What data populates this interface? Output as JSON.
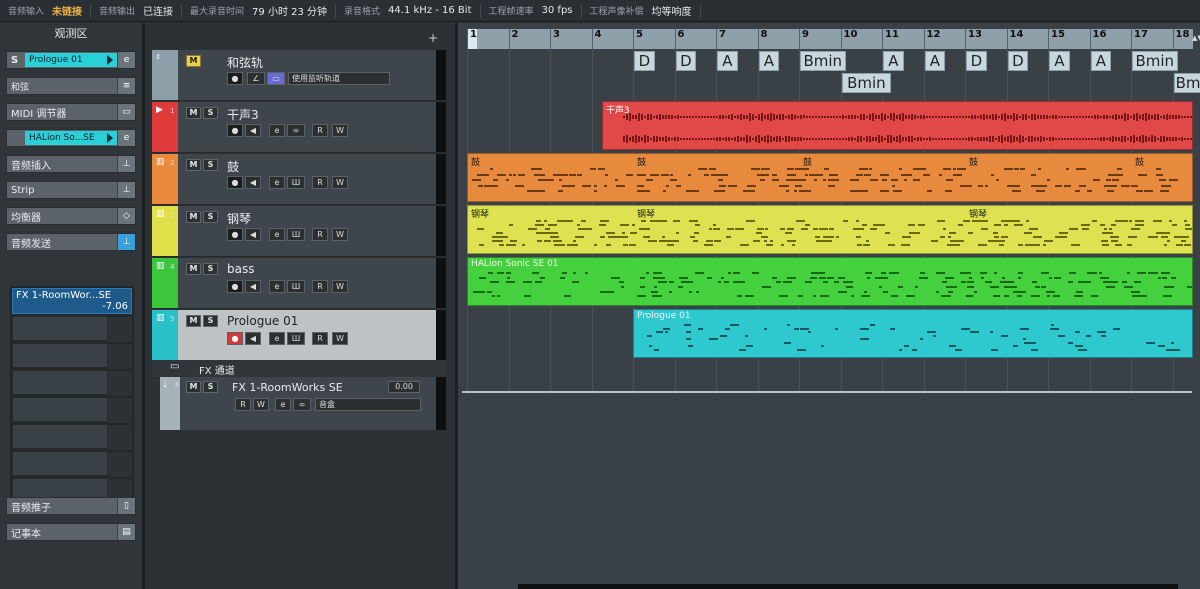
{
  "statusbar": {
    "audio_in_key": "音频输入",
    "audio_in_val": "未链接",
    "audio_out_key": "音频输出",
    "audio_out_val": "已连接",
    "max_rec_key": "最大录音时间",
    "max_rec_val": "79 小时 23 分钟",
    "rec_fmt_key": "录音格式",
    "rec_fmt_val": "44.1 kHz - 16 Bit",
    "frame_key": "工程帧速率",
    "frame_val": "30 fps",
    "pan_key": "工程声像补偿",
    "pan_val": "均等响度"
  },
  "inspector": {
    "title": "观测区",
    "s_label": "S",
    "instrument": "Prologue 01",
    "chords": "和弦",
    "midi_mod": "MIDI 调节器",
    "halion": "HALion So...SE",
    "audio_insert": "音频插入",
    "strip": "Strip",
    "eq": "均衡器",
    "audio_send": "音频发送",
    "send1_name": "FX 1-RoomWor...SE",
    "send1_val": "-7.06",
    "fader": "音频推子",
    "notepad": "记事本"
  },
  "tracks": [
    {
      "num": "",
      "name": "和弦轨",
      "color": "#8d9fa9",
      "mute": "M",
      "solo": "",
      "chord_mode": "使用监听轨道"
    },
    {
      "num": "1",
      "name": "干声3",
      "color": "#e03a3a",
      "mute": "M",
      "solo": "S"
    },
    {
      "num": "2",
      "name": "鼓",
      "color": "#e98a3c",
      "mute": "M",
      "solo": "S"
    },
    {
      "num": "3",
      "name": "钢琴",
      "color": "#dfe04a",
      "mute": "M",
      "solo": "S"
    },
    {
      "num": "4",
      "name": "bass",
      "color": "#3cc63c",
      "mute": "M",
      "solo": "S"
    },
    {
      "num": "5",
      "name": "Prologue 01",
      "color": "#2ac0c8",
      "mute": "M",
      "solo": "S"
    }
  ],
  "ctl_labels": {
    "rec": "●",
    "mon": "◀",
    "e": "e",
    "r": "R",
    "w": "W"
  },
  "fx": {
    "folder": "FX 通道",
    "num": "6",
    "name": "FX 1-RoomWorks SE",
    "time": "0.00",
    "mute": "M",
    "solo": "S",
    "r": "R",
    "w": "W",
    "e": "e",
    "insert": "音盒"
  },
  "ruler": {
    "bars": [
      "1",
      "2",
      "3",
      "4",
      "5",
      "6",
      "7",
      "8",
      "9",
      "10",
      "11",
      "12",
      "13",
      "14",
      "15",
      "16",
      "17",
      "18"
    ]
  },
  "chords_row1": [
    "D",
    "D",
    "A",
    "A",
    "Bmin",
    "A",
    "A",
    "D",
    "D",
    "A",
    "A",
    "Bmin"
  ],
  "chords_row2": [
    "Bmin",
    "Bm"
  ],
  "clips": {
    "vocal": "干声3",
    "drum": "鼓",
    "piano": "钢琴",
    "bass": "HALion Sonic SE 01",
    "prologue": "Prologue 01"
  },
  "colors": {
    "vocal": "#e14848",
    "drum": "#e88a3e",
    "piano": "#dfe250",
    "bass": "#45d13d",
    "prologue": "#2ec8cf"
  }
}
